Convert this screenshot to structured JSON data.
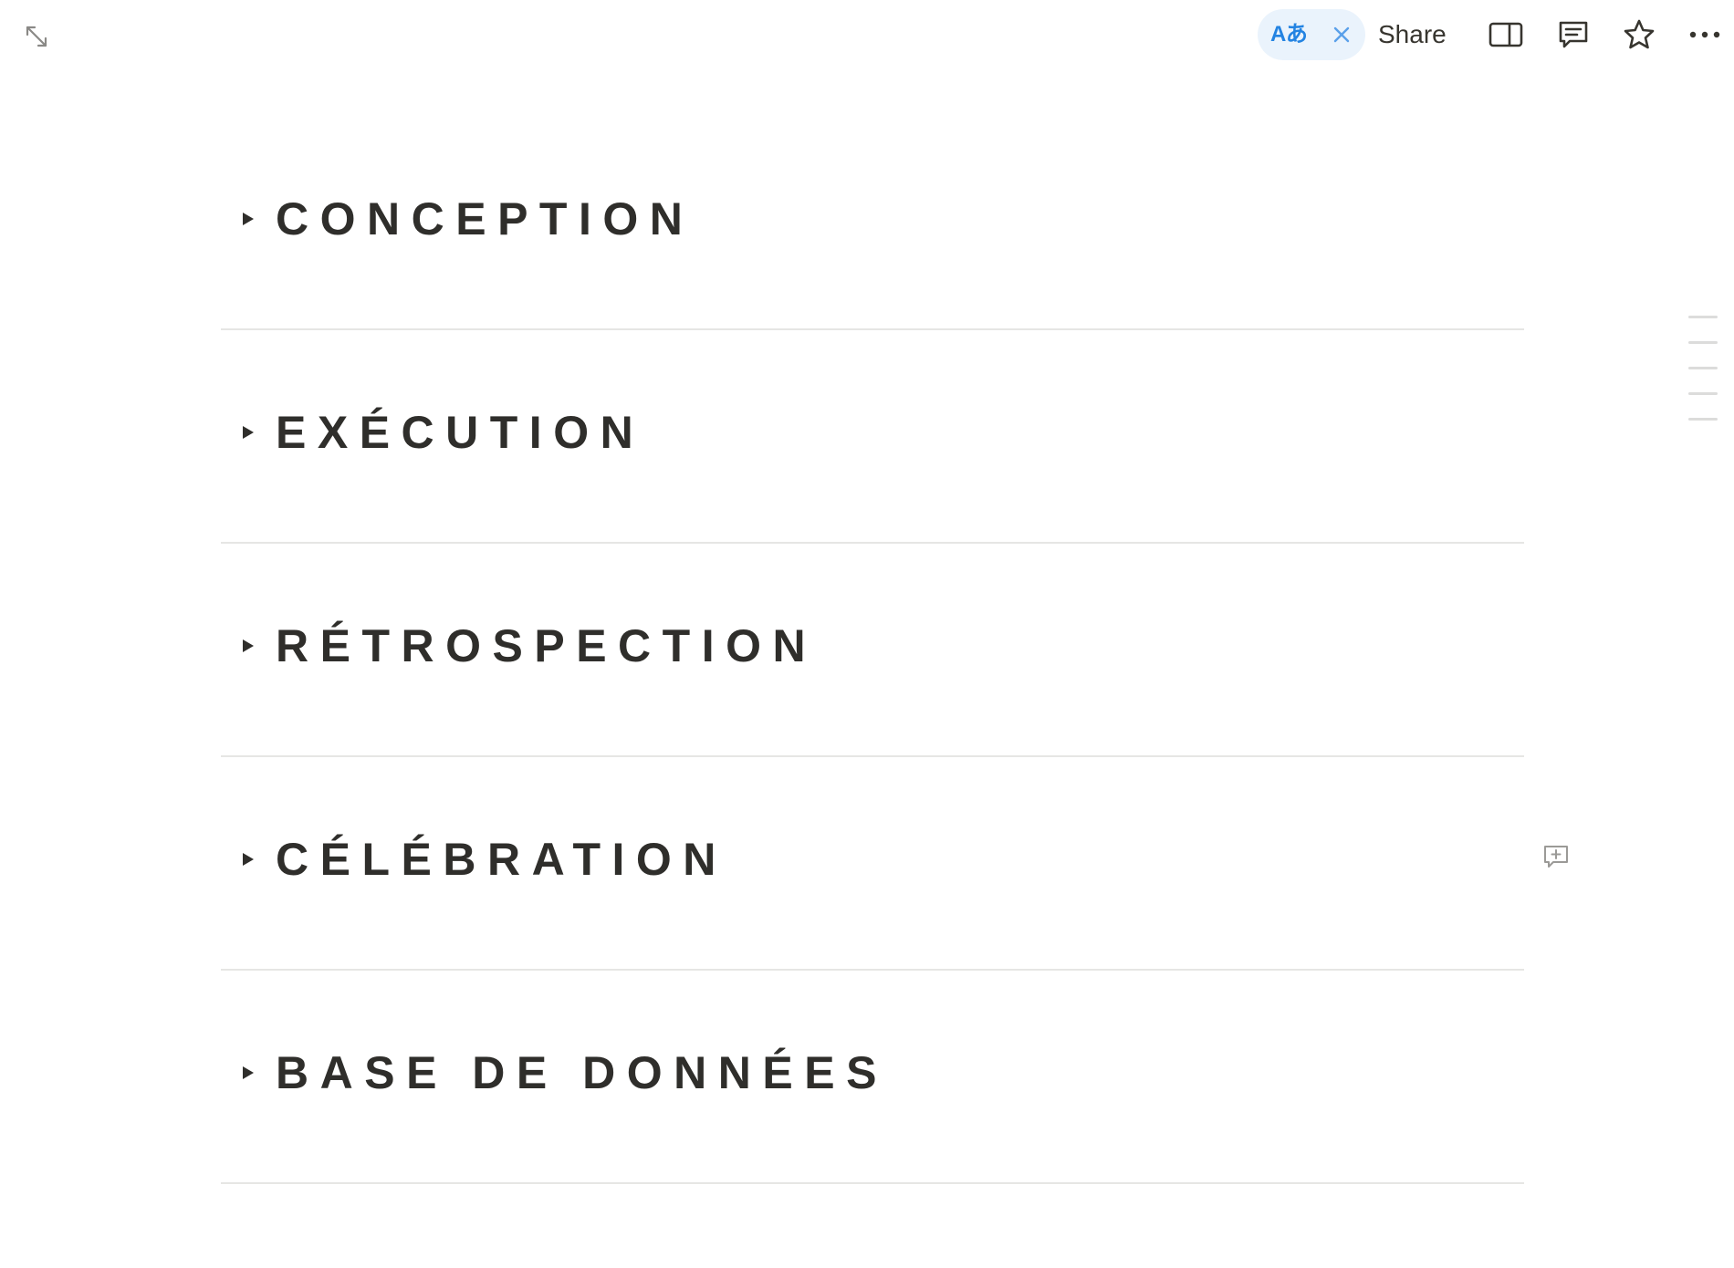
{
  "topbar": {
    "translate_badge": "Aあ",
    "share_label": "Share",
    "icons": [
      "collapse-icon",
      "close-icon",
      "sidebar-panel-icon",
      "comments-icon",
      "star-icon",
      "more-icon"
    ]
  },
  "toggles": [
    {
      "label": "CONCEPTION"
    },
    {
      "label": "EXÉCUTION"
    },
    {
      "label": "RÉTROSPECTION"
    },
    {
      "label": "CÉLÉBRATION"
    },
    {
      "label": "BASE DE DONNÉES"
    }
  ],
  "colors": {
    "accent": "#2383e2",
    "pill_bg": "#eaf3fc",
    "text": "#2f2e2b",
    "divider": "#e6e6e4"
  }
}
